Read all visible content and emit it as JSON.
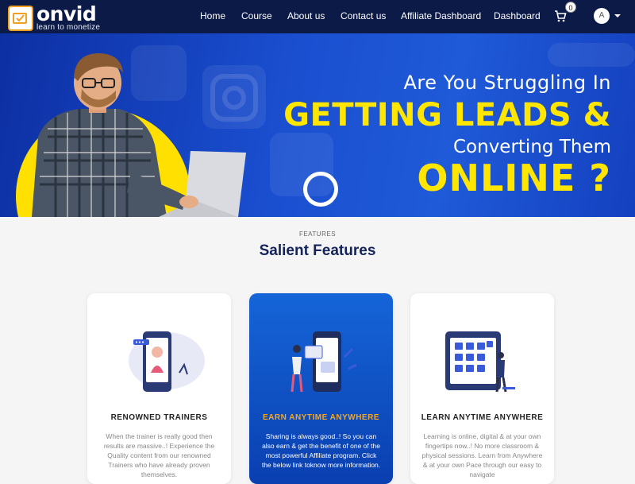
{
  "brand": {
    "name": "onvid",
    "tagline": "learn to monetize"
  },
  "nav": {
    "items": [
      "Home",
      "Course",
      "About us",
      "Contact us",
      "Affiliate Dashboard",
      "Dashboard"
    ],
    "cart_count": "0",
    "avatar_initial": "A"
  },
  "hero": {
    "line1": "Are You Struggling In",
    "line2": "GETTING LEADS &",
    "line3": "Converting Them",
    "line4": "ONLINE ?"
  },
  "features": {
    "eyebrow": "FEATURES",
    "title": "Salient Features",
    "cards": [
      {
        "heading": "RENOWNED TRAINERS",
        "body": "When the trainer is really good then results are massive..! Experience the Quality content from our renowned Trainers who have already proven themselves."
      },
      {
        "heading": "EARN ANYTIME ANYWHERE",
        "body": "Sharing is always good..! So you can also earn & get the benefit of one of the most powerful Affiliate program. Click the below link toknow  more information."
      },
      {
        "heading": "LEARN ANYTIME ANYWHERE",
        "body": "Learning is online, digital & at your own fingertips now..! No more classroom & physical sessions. Learn from Anywhere & at your own Pace through our easy to navigate"
      }
    ]
  },
  "colors": {
    "navbar": "#0c1a47",
    "hero_blue": "#1a4fd0",
    "accent_yellow": "#ffe600",
    "card_active": "#1565d8",
    "card_heading_orange": "#f5a623"
  }
}
